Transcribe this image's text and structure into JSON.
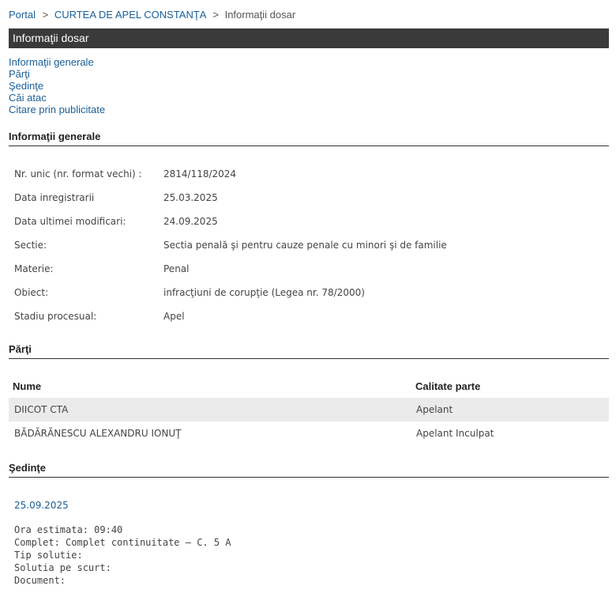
{
  "breadcrumb": {
    "items": [
      "Portal",
      "CURTEA DE APEL CONSTANŢA",
      "Informaţii dosar"
    ],
    "separator": ">"
  },
  "title": "Informaţii dosar",
  "nav": [
    "Informaţii generale",
    "Părţi",
    "Şedinţe",
    "Căi atac",
    "Citare prin publicitate"
  ],
  "sections": {
    "general": "Informaţii generale",
    "parti": "Părţi",
    "sedinte": "Şedinţe"
  },
  "general_info": [
    {
      "label": "Nr. unic (nr. format vechi) :",
      "value": "2814/118/2024"
    },
    {
      "label": "Data inregistrarii",
      "value": "25.03.2025"
    },
    {
      "label": "Data ultimei modificari:",
      "value": "24.09.2025"
    },
    {
      "label": "Sectie:",
      "value": "Sectia penală şi pentru cauze penale cu minori şi de familie"
    },
    {
      "label": "Materie:",
      "value": "Penal"
    },
    {
      "label": "Obiect:",
      "value": "infracţiuni de corupţie (Legea nr. 78/2000)"
    },
    {
      "label": "Stadiu procesual:",
      "value": "Apel"
    }
  ],
  "parti": {
    "headers": {
      "name": "Nume",
      "role": "Calitate parte"
    },
    "rows": [
      {
        "name": "DIICOT CTA",
        "role": "Apelant"
      },
      {
        "name": "BĂDĂRĂNESCU ALEXANDRU IONUŢ",
        "role": "Apelant Inculpat"
      }
    ]
  },
  "sedinte": {
    "date": "25.09.2025",
    "details": [
      "Ora estimata: 09:40",
      "Complet: Complet continuitate – C. 5 A",
      "Tip solutie:",
      "Solutia pe scurt:",
      "Document:"
    ]
  },
  "colors": {
    "link": "#1a5f96",
    "title_bar": "#3a3a3a",
    "alt_row": "#ebebeb"
  }
}
